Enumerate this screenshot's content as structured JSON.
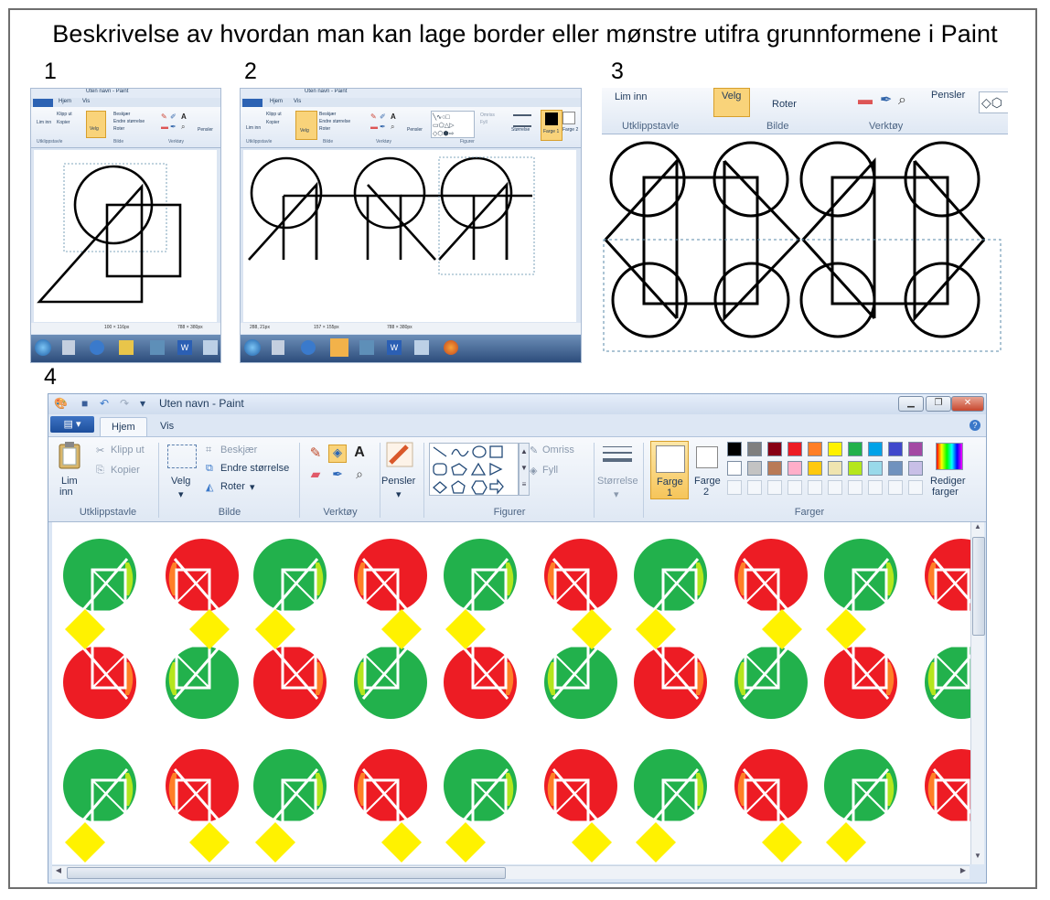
{
  "title": "Beskrivelse av hvordan man kan lage border eller mønstre utifra grunnformene i Paint",
  "step_numbers": [
    "1",
    "2",
    "3",
    "4"
  ],
  "panel1": {
    "window_title": "Uten navn - Paint",
    "tabs": [
      "Hjem",
      "Vis"
    ],
    "buttons": [
      "Lim inn",
      "Klipp ut",
      "Kopier",
      "Velg",
      "Beskjær",
      "Endre størrelse",
      "Roter",
      "Pensler"
    ],
    "groups": [
      "Utklippstavle",
      "Bilde",
      "Verktøy"
    ],
    "status": [
      "100 × 116px",
      "788 × 380px"
    ]
  },
  "panel2": {
    "window_title": "Uten navn - Paint",
    "tabs": [
      "Hjem",
      "Vis"
    ],
    "buttons": [
      "Lim inn",
      "Klipp ut",
      "Kopier",
      "Velg",
      "Beskjær",
      "Endre størrelse",
      "Roter",
      "Pensler",
      "Omriss",
      "Fyll",
      "Størrelse",
      "Farge 1",
      "Farge 2"
    ],
    "groups": [
      "Utklippstavle",
      "Bilde",
      "Verktøy",
      "Figurer"
    ],
    "status": [
      "288, 21px",
      "157 × 155px",
      "788 × 380px"
    ]
  },
  "panel3": {
    "buttons": [
      "Lim inn",
      "Velg",
      "Roter",
      "Pensler"
    ],
    "groups": [
      "Utklippstavle",
      "Bilde",
      "Verktøy"
    ]
  },
  "panel4": {
    "window_title": "Uten navn - Paint",
    "tabs": [
      "Hjem",
      "Vis"
    ],
    "file_button": "▤ ▾",
    "clipboard": {
      "paste": "Lim",
      "paste2": "inn",
      "cut": "Klipp ut",
      "copy": "Kopier",
      "label": "Utklippstavle"
    },
    "image": {
      "select": "Velg",
      "crop": "Beskjær",
      "resize": "Endre størrelse",
      "rotate": "Roter",
      "label": "Bilde"
    },
    "tools": {
      "label": "Verktøy"
    },
    "brushes": "Pensler",
    "shapes": {
      "outline": "Omriss",
      "fill": "Fyll",
      "label": "Figurer"
    },
    "size": "Størrelse",
    "color1": {
      "line1": "Farge",
      "line2": "1"
    },
    "color2": {
      "line1": "Farge",
      "line2": "2"
    },
    "colors_label": "Farger",
    "edit_colors": {
      "line1": "Rediger",
      "line2": "farger"
    },
    "palette_row1": [
      "#000000",
      "#7f7f7f",
      "#880015",
      "#ed1c24",
      "#ff7f27",
      "#fff200",
      "#22b14c",
      "#00a2e8",
      "#3f48cc",
      "#a349a4"
    ],
    "palette_row2": [
      "#ffffff",
      "#c3c3c3",
      "#b97a57",
      "#ffaec9",
      "#ffc90e",
      "#efe4b0",
      "#b5e61d",
      "#99d9ea",
      "#7092be",
      "#c8bfe7"
    ]
  }
}
